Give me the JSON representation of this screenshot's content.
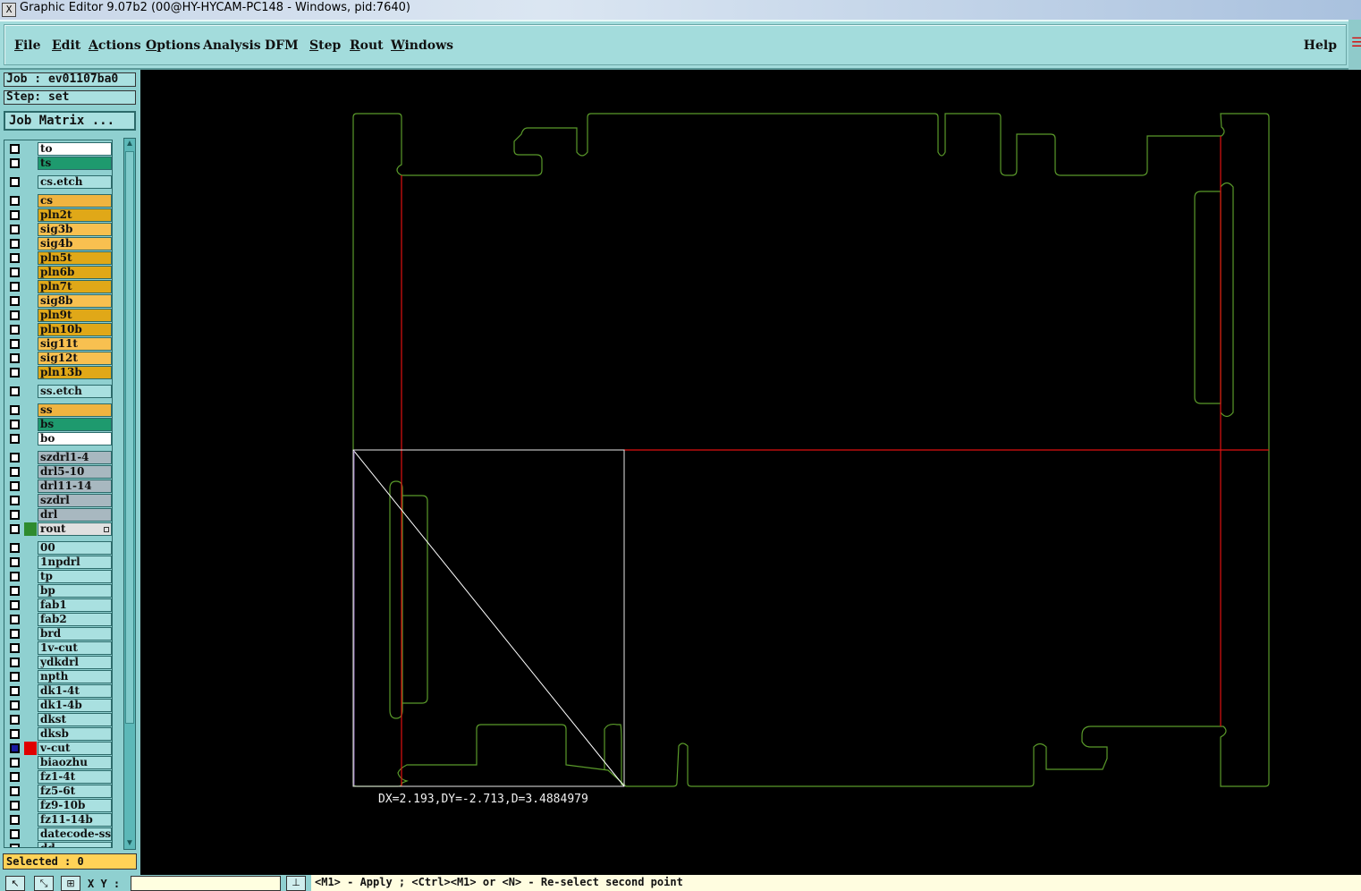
{
  "window": {
    "title": "Graphic Editor 9.07b2 (00@HY-HYCAM-PC148 - Windows, pid:7640)",
    "icon": "app-x-icon"
  },
  "menu": {
    "file": {
      "pre": "",
      "u": "F",
      "post": "ile"
    },
    "edit": {
      "pre": "",
      "u": "E",
      "post": "dit"
    },
    "actions": {
      "pre": "",
      "u": "A",
      "post": "ctions"
    },
    "options": {
      "pre": "",
      "u": "O",
      "post": "ptions"
    },
    "analysis": {
      "pre": "Analysis",
      "u": "",
      "post": ""
    },
    "dfm": {
      "pre": "DFM",
      "u": "",
      "post": ""
    },
    "step": {
      "pre": "",
      "u": "S",
      "post": "tep"
    },
    "rout": {
      "pre": "",
      "u": "R",
      "post": "out"
    },
    "windows": {
      "pre": "",
      "u": "W",
      "post": "indows"
    },
    "help": {
      "pre": "Help",
      "u": "",
      "post": ""
    }
  },
  "panel": {
    "job": "Job : ev01107ba0",
    "step": "Step: set",
    "job_matrix": "Job Matrix ...",
    "selected": "Selected : 0"
  },
  "layers": [
    {
      "name": "to",
      "color": "#ffffff",
      "affected": false
    },
    {
      "name": "ts",
      "color": "#1e9a6e",
      "affected": false
    },
    {
      "name": "cs.etch",
      "color": "#a9e0e0",
      "affected": false,
      "gap": true
    },
    {
      "name": "cs",
      "color": "#f0b440",
      "affected": false,
      "gap": true
    },
    {
      "name": "pln2t",
      "color": "#e0a818",
      "affected": false
    },
    {
      "name": "sig3b",
      "color": "#f8c050",
      "affected": false
    },
    {
      "name": "sig4b",
      "color": "#f8c050",
      "affected": false
    },
    {
      "name": "pln5t",
      "color": "#e0a818",
      "affected": false
    },
    {
      "name": "pln6b",
      "color": "#e0a818",
      "affected": false
    },
    {
      "name": "pln7t",
      "color": "#e0a818",
      "affected": false
    },
    {
      "name": "sig8b",
      "color": "#f8c050",
      "affected": false
    },
    {
      "name": "pln9t",
      "color": "#e0a818",
      "affected": false
    },
    {
      "name": "pln10b",
      "color": "#e0a818",
      "affected": false
    },
    {
      "name": "sig11t",
      "color": "#f8c050",
      "affected": false
    },
    {
      "name": "sig12t",
      "color": "#f8c050",
      "affected": false
    },
    {
      "name": "pln13b",
      "color": "#e0a818",
      "affected": false
    },
    {
      "name": "ss.etch",
      "color": "#a9e0e0",
      "affected": false,
      "gap": true
    },
    {
      "name": "ss",
      "color": "#f0b440",
      "affected": false,
      "gap": true
    },
    {
      "name": "bs",
      "color": "#1e9a6e",
      "affected": false
    },
    {
      "name": "bo",
      "color": "#ffffff",
      "affected": false
    },
    {
      "name": "szdrl1-4",
      "color": "#a8b8c0",
      "affected": false,
      "gap": true
    },
    {
      "name": "drl5-10",
      "color": "#a8b8c0",
      "affected": false
    },
    {
      "name": "drl11-14",
      "color": "#a8b8c0",
      "affected": false
    },
    {
      "name": "szdrl",
      "color": "#a8b8c0",
      "affected": false
    },
    {
      "name": "drl",
      "color": "#a8b8c0",
      "affected": false
    },
    {
      "name": "rout",
      "color": "#e0e0e0",
      "affected": "green",
      "dot": true
    },
    {
      "name": "00",
      "color": "#a9e0e0",
      "affected": false,
      "gap": true
    },
    {
      "name": "1npdrl",
      "color": "#a9e0e0",
      "affected": false
    },
    {
      "name": "tp",
      "color": "#a9e0e0",
      "affected": false
    },
    {
      "name": "bp",
      "color": "#a9e0e0",
      "affected": false
    },
    {
      "name": "fab1",
      "color": "#a9e0e0",
      "affected": false
    },
    {
      "name": "fab2",
      "color": "#a9e0e0",
      "affected": false
    },
    {
      "name": "brd",
      "color": "#a9e0e0",
      "affected": false
    },
    {
      "name": "1v-cut",
      "color": "#a9e0e0",
      "affected": false
    },
    {
      "name": "ydkdrl",
      "color": "#a9e0e0",
      "affected": false
    },
    {
      "name": "npth",
      "color": "#a9e0e0",
      "affected": false
    },
    {
      "name": "dk1-4t",
      "color": "#a9e0e0",
      "affected": false
    },
    {
      "name": "dk1-4b",
      "color": "#a9e0e0",
      "affected": false
    },
    {
      "name": "dkst",
      "color": "#a9e0e0",
      "affected": false
    },
    {
      "name": "dksb",
      "color": "#a9e0e0",
      "affected": false
    },
    {
      "name": "v-cut",
      "color": "#a9e0e0",
      "affected": "red",
      "checked": true
    },
    {
      "name": "biaozhu",
      "color": "#a9e0e0",
      "affected": false
    },
    {
      "name": "fz1-4t",
      "color": "#a9e0e0",
      "affected": false
    },
    {
      "name": "fz5-6t",
      "color": "#a9e0e0",
      "affected": false
    },
    {
      "name": "fz9-10b",
      "color": "#a9e0e0",
      "affected": false
    },
    {
      "name": "fz11-14b",
      "color": "#a9e0e0",
      "affected": false
    },
    {
      "name": "datecode-ss",
      "color": "#a9e0e0",
      "affected": false
    },
    {
      "name": "dd",
      "color": "#a9e0e0",
      "affected": false
    }
  ],
  "canvas": {
    "measure_readout": "DX=2.193,DY=-2.713,D=3.4884979",
    "colors": {
      "outline": "#5a9a2a",
      "cut": "#e01010",
      "measure": "#ffffff",
      "edge": "#8a6ab0"
    }
  },
  "bottom": {
    "xy_label": "X Y :",
    "xy_value": "",
    "message": "<M1> - Apply  ; <Ctrl><M1> or <N> - Re-select second point",
    "icons": [
      "pointer-icon",
      "measure-icon",
      "grid-icon",
      "snap-icon"
    ]
  }
}
